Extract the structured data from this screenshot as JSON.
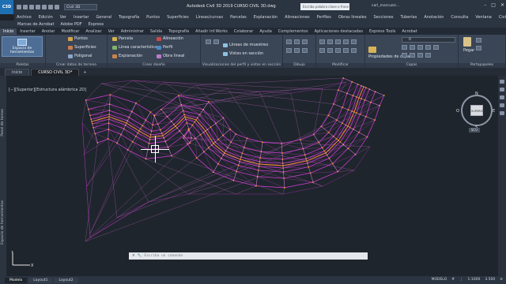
{
  "titlebar": {
    "app_icon": "C3D",
    "workspace": "Civil 3D",
    "title": "Autodesk Civil 3D 2019   CURSO CIVIL 3D.dwg",
    "search": "Escriba palabra clave o frase",
    "user": "carl_marcuzzi..."
  },
  "menu": [
    "Archivo",
    "Edición",
    "Ver",
    "Insertar",
    "General",
    "Topografía",
    "Puntos",
    "Superficies",
    "Líneas/curvas",
    "Parcelas",
    "Explanación",
    "Alineaciones",
    "Perfiles",
    "Obras lineales",
    "Secciones",
    "Tuberías",
    "Anotación",
    "Consulta",
    "Ventana",
    "CivilCAD"
  ],
  "menu2": [
    "Marcas de Acrobat",
    "Adobe PDF",
    "Express"
  ],
  "ribbon_tabs": [
    {
      "label": "Inicio",
      "active": true
    },
    {
      "label": "Insertar"
    },
    {
      "label": "Anotar"
    },
    {
      "label": "Modificar"
    },
    {
      "label": "Analizar"
    },
    {
      "label": "Ver"
    },
    {
      "label": "Administrar"
    },
    {
      "label": "Salida"
    },
    {
      "label": "Topografía"
    },
    {
      "label": "Añadir Inf.Works"
    },
    {
      "label": "Colaborar"
    },
    {
      "label": "Ayuda"
    },
    {
      "label": "Complementos"
    },
    {
      "label": "Aplicaciones destacadas"
    },
    {
      "label": "Express Tools"
    },
    {
      "label": "Acrobat"
    }
  ],
  "ribbon": {
    "big_button": "Espacio de herramientas",
    "panel_palettes": "Paletas",
    "points": "Puntos",
    "surfaces": "Superficies",
    "polygonal": "Poligonal",
    "panel_ground": "Crear datos de terreno",
    "parcel": "Parcela",
    "featline": "Línea característica",
    "grading": "Explanación",
    "alignment": "Alineación",
    "profile": "Perfil",
    "corridor": "Obra lineal",
    "panel_design": "Crear diseño",
    "sample_lines": "Líneas de muestreo",
    "section_views": "Vistas en sección",
    "panel_views": "Visualizaciones del perfil y vistas en sección",
    "panel_draw": "Dibujo",
    "panel_modify": "Modificar",
    "layer_props": "Propiedades de capa",
    "panel_layers": "Capas",
    "paste": "Pegar",
    "panel_clip": "Portapapeles",
    "layer_value": "0"
  },
  "doc_tabs": [
    {
      "label": "Inicio"
    },
    {
      "label": "CURSO CIVIL 3D*",
      "active": true
    }
  ],
  "viewport_label": "[−][Superior][Estructura alámbrica 2D]",
  "side_palettes": [
    "Panel de tareas",
    "Espacio de herramientas"
  ],
  "navcube": {
    "face": "SUPERIOR",
    "n": "N",
    "s": "S",
    "e": "E",
    "w": "O",
    "wcs": "SCU"
  },
  "command_placeholder": "Escriba un comando",
  "layout_tabs": [
    {
      "label": "Modelo",
      "active": true
    },
    {
      "label": "Layout1"
    },
    {
      "label": "Layout2"
    }
  ],
  "status": {
    "mode": "MODELO",
    "scale": "1:1000",
    "elev": "3.500"
  },
  "colors": {
    "mesh": "#c43bc8",
    "mesh_light": "#e07be3",
    "contour": "#ff9a2a",
    "bg": "#1f252d"
  }
}
